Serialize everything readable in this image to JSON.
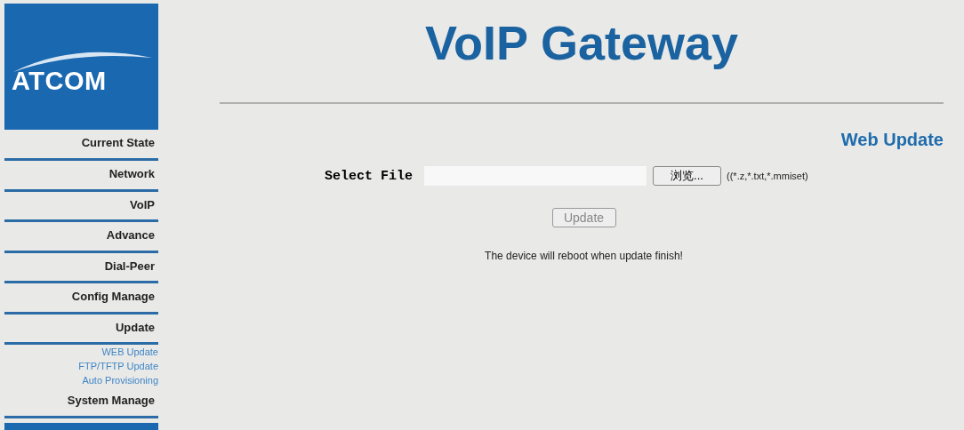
{
  "logo": {
    "text": "ATCOM"
  },
  "menu": [
    {
      "label": "Current State",
      "kind": "main"
    },
    {
      "label": "Network",
      "kind": "main"
    },
    {
      "label": "VoIP",
      "kind": "main"
    },
    {
      "label": "Advance",
      "kind": "main"
    },
    {
      "label": "Dial-Peer",
      "kind": "main"
    },
    {
      "label": "Config Manage",
      "kind": "main"
    },
    {
      "label": "Update",
      "kind": "main"
    },
    {
      "label": "WEB Update",
      "kind": "sub"
    },
    {
      "label": "FTP/TFTP Update",
      "kind": "sub"
    },
    {
      "label": "Auto Provisioning",
      "kind": "sub"
    },
    {
      "label": "System Manage",
      "kind": "main"
    }
  ],
  "header": {
    "title": "VoIP Gateway"
  },
  "section_title": "Web Update",
  "form": {
    "label": "Select File",
    "browse_button": "浏览...",
    "hint": "((*.z,*.txt,*.mmiset)",
    "update_button": "Update",
    "update_disabled": true,
    "note": "The device will reboot when update finish!"
  }
}
